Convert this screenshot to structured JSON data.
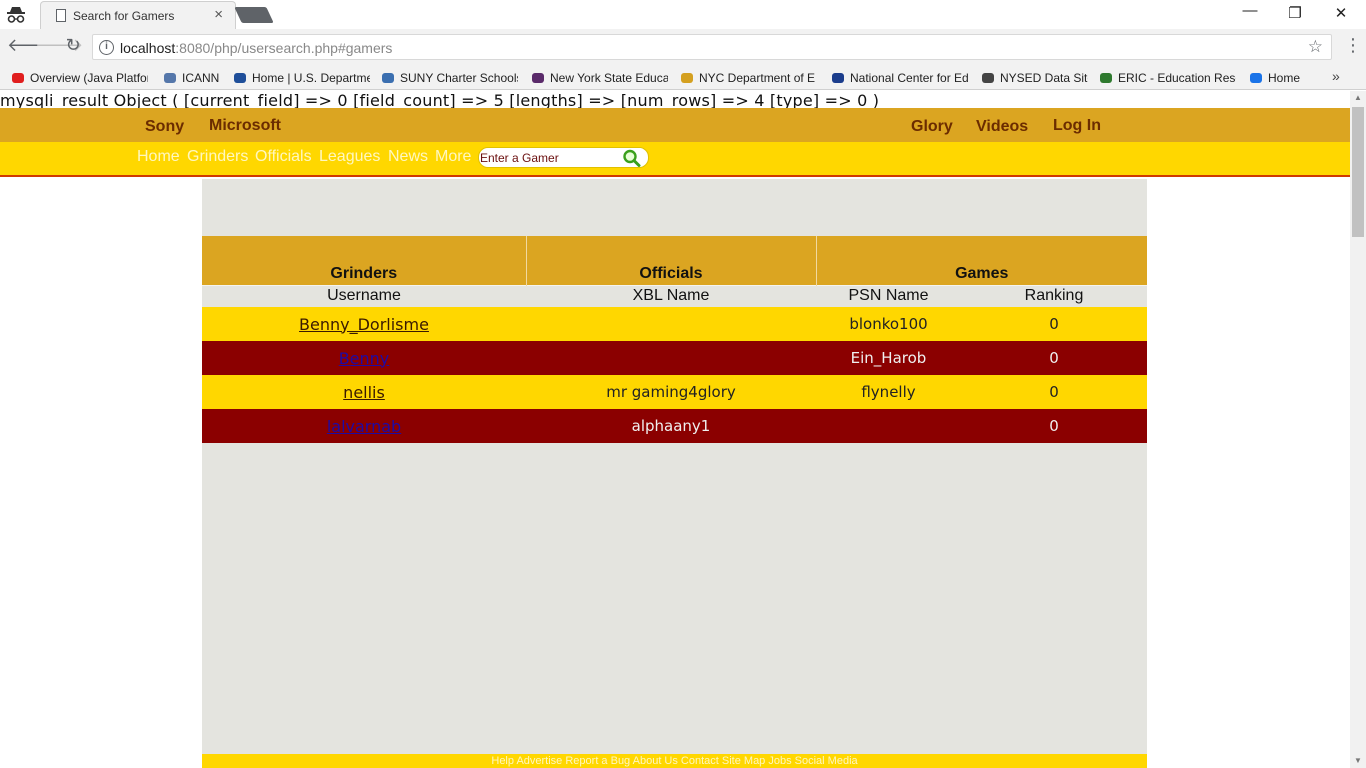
{
  "browser": {
    "tab_title": "Search for Gamers",
    "tab_close": "×",
    "url_host": "localhost",
    "url_rest": ":8080/php/usersearch.php#gamers",
    "win_min": "—",
    "win_restore": "❐",
    "win_close": "✕",
    "bookmarks": [
      {
        "label": "Overview (Java Platfor",
        "icon": "oracle-icon",
        "color": "#e01e1e"
      },
      {
        "label": "ICANN",
        "icon": "icann-icon",
        "color": "#5577aa"
      },
      {
        "label": "Home | U.S. Departme",
        "icon": "doe-seal-icon",
        "color": "#1f4f9a"
      },
      {
        "label": "SUNY Charter Schools",
        "icon": "suny-icon",
        "color": "#3b6fb0"
      },
      {
        "label": "New York State Educa",
        "icon": "nysed-icon",
        "color": "#5a2a6a"
      },
      {
        "label": "NYC Department of E",
        "icon": "nycdoe-icon",
        "color": "#d4a020"
      },
      {
        "label": "National Center for Ed",
        "icon": "nces-icon",
        "color": "#1b3d8c"
      },
      {
        "label": "NYSED Data Site",
        "icon": "chart-icon",
        "color": "#444444"
      },
      {
        "label": "ERIC - Education Reso",
        "icon": "eric-icon",
        "color": "#2f7a2f"
      },
      {
        "label": "Home",
        "icon": "chevrons-icon",
        "color": "#1a73e8"
      }
    ],
    "bookmarks_more": "»"
  },
  "debug_text": "mysqli_result Object ( [current_field] => 0 [field_count] => 5 [lengths] => [num_rows] => 4 [type] => 0 )",
  "nav": {
    "top_left": [
      "Sony",
      "Microsoft"
    ],
    "top_right": [
      "Glory",
      "Videos",
      "Log In"
    ],
    "menu": [
      "Home",
      "Grinders",
      "Officials",
      "Leagues",
      "News",
      "More"
    ],
    "search_placeholder": "Enter a Gamer"
  },
  "table": {
    "group_headers": [
      "Grinders",
      "Officials",
      "Games"
    ],
    "columns": [
      "Username",
      "XBL Name",
      "PSN Name",
      "Ranking"
    ],
    "rows": [
      {
        "username": "Benny_Dorlisme",
        "xbl": "",
        "psn": "blonko100",
        "ranking": "0"
      },
      {
        "username": "Benny",
        "xbl": "",
        "psn": "Ein_Harob",
        "ranking": "0"
      },
      {
        "username": "nellis",
        "xbl": "mr gaming4glory",
        "psn": "flynelly",
        "ranking": "0"
      },
      {
        "username": "lalvarnab",
        "xbl": "alphaany1",
        "psn": "",
        "ranking": "0"
      }
    ]
  },
  "footer": "Help Advertise Report a Bug About Us Contact Site Map Jobs Social Media"
}
